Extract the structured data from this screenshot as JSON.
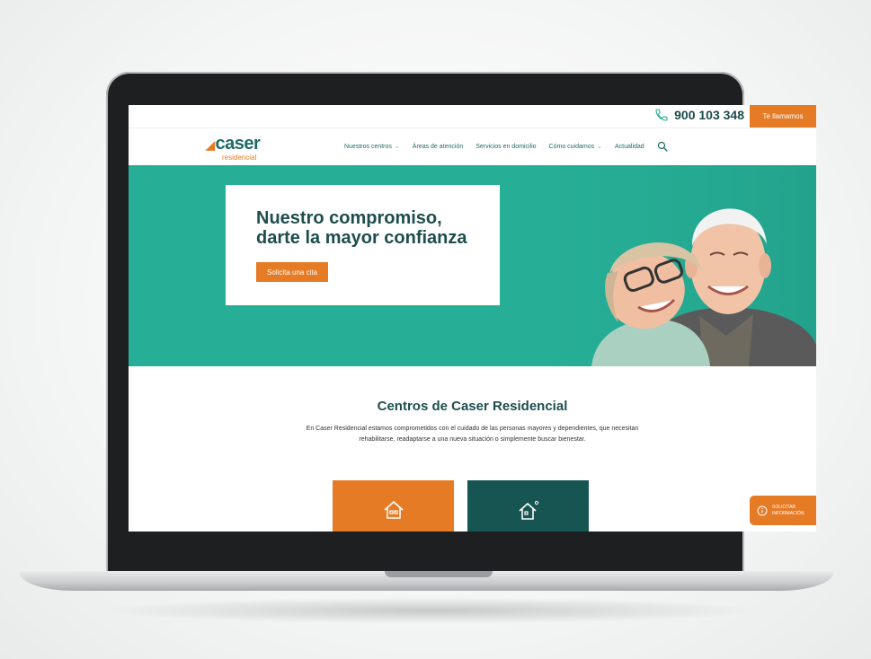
{
  "topbar": {
    "phone": "900 103 348",
    "call_label": "Te llamamos"
  },
  "logo": {
    "brand": "caser",
    "sub": "residencial"
  },
  "nav": [
    {
      "label": "Nuestros centros",
      "dropdown": true
    },
    {
      "label": "Áreas de atención",
      "dropdown": false
    },
    {
      "label": "Servicios en domicilio",
      "dropdown": false
    },
    {
      "label": "Cómo cuidamos",
      "dropdown": true
    },
    {
      "label": "Actualidad",
      "dropdown": false
    }
  ],
  "hero": {
    "title_line1": "Nuestro compromiso,",
    "title_line2": "darte la mayor confianza",
    "button": "Solicita una cita"
  },
  "section": {
    "title": "Centros de Caser Residencial",
    "text": "En Caser Residencial estamos comprometidos con el cuidado de las personas mayores y dependientes, que necesitan rehabilitarse, readaptarse a una nueva situación o simplemente buscar bienestar."
  },
  "info_button": {
    "line1": "SOLICITAR",
    "line2": "INFORMACIÓN"
  },
  "colors": {
    "accent": "#e67b25",
    "teal": "#27ae96",
    "dark_teal": "#175552",
    "text_dark": "#1e4d4d"
  },
  "icons": [
    "phone-icon",
    "search-icon",
    "house-icon",
    "house-sun-icon",
    "info-icon"
  ]
}
